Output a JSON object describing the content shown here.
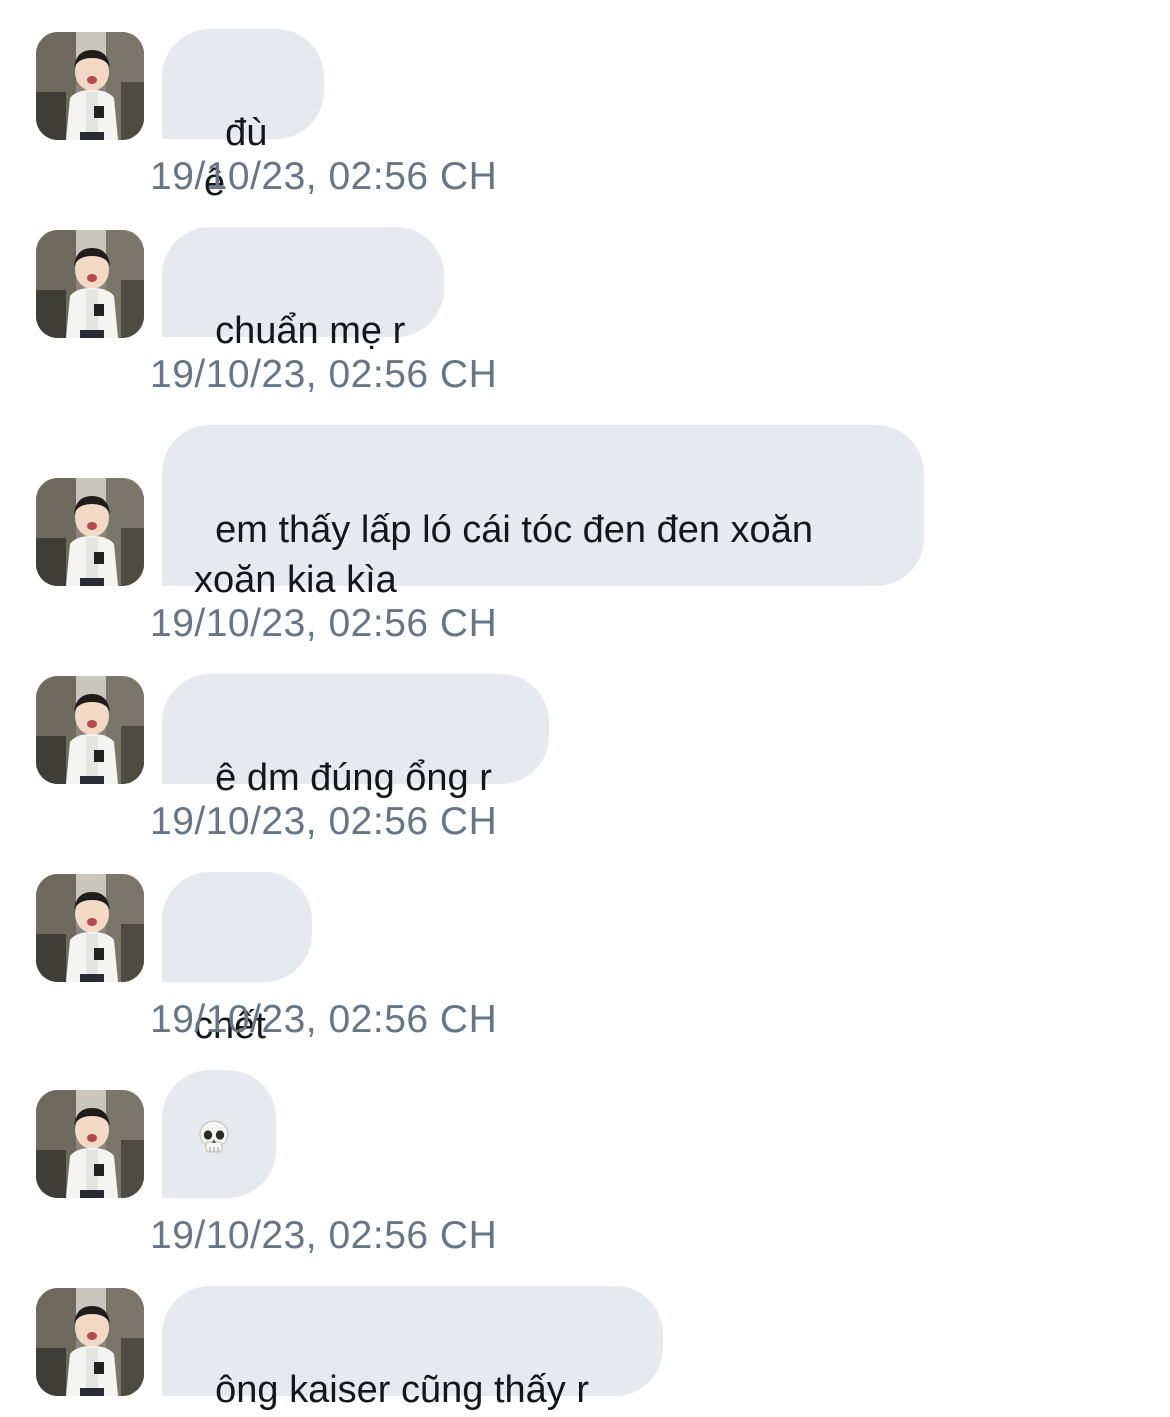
{
  "conversation": {
    "messages": [
      {
        "text": "đù ê",
        "timestamp": "19/10/23, 02:56 CH"
      },
      {
        "text": "chuẩn mẹ r",
        "timestamp": "19/10/23, 02:56 CH"
      },
      {
        "text": "em thấy lấp ló cái tóc đen đen xoăn\nxoăn kia kìa",
        "timestamp": "19/10/23, 02:56 CH"
      },
      {
        "text": "ê dm đúng ổng r",
        "timestamp": "19/10/23, 02:56 CH"
      },
      {
        "text": "chết",
        "timestamp": "19/10/23, 02:56 CH"
      },
      {
        "emoji": "skull-icon",
        "timestamp": "19/10/23, 02:56 CH"
      },
      {
        "text": "ông kaiser cũng thấy r",
        "timestamp": ""
      }
    ]
  },
  "colors": {
    "bubble_background": "#e6eaee",
    "message_text": "#14171a",
    "timestamp_text": "#687684",
    "page_background": "#ffffff"
  }
}
